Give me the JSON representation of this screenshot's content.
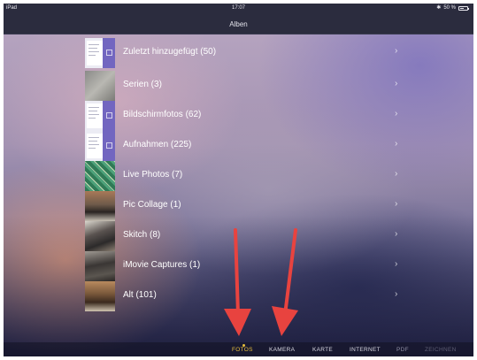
{
  "status_bar": {
    "device": "iPad",
    "time": "17:07",
    "bluetooth_icon": "bluetooth-icon",
    "battery": "50 %",
    "battery_icon": "battery-icon"
  },
  "navbar": {
    "title": "Alben"
  },
  "albums": [
    {
      "label": "Zuletzt hinzugefügt (50)",
      "thumb": "document-screenshot"
    },
    {
      "label": "Serien (3)",
      "thumb": "gray-photo"
    },
    {
      "label": "Bildschirmfotos (62)",
      "thumb": "document-screenshot"
    },
    {
      "label": "Aufnahmen (225)",
      "thumb": "document-screenshot"
    },
    {
      "label": "Live Photos (7)",
      "thumb": "green-pattern-photo"
    },
    {
      "label": "Pic Collage (1)",
      "thumb": "room-photo"
    },
    {
      "label": "Skitch (8)",
      "thumb": "classroom-photo"
    },
    {
      "label": "iMovie Captures (1)",
      "thumb": "classroom-photo"
    },
    {
      "label": "Alt (101)",
      "thumb": "room-photo"
    }
  ],
  "chevron_glyph": "›",
  "tabs": [
    {
      "label": "FOTOS",
      "state": "active"
    },
    {
      "label": "KAMERA",
      "state": "normal"
    },
    {
      "label": "KARTE",
      "state": "normal"
    },
    {
      "label": "INTERNET",
      "state": "normal"
    },
    {
      "label": "PDF",
      "state": "faded"
    },
    {
      "label": "ZEICHNEN",
      "state": "very-faded"
    }
  ],
  "colors": {
    "bar_background": "#2b2c3e",
    "active_tab": "#e6bd3c",
    "annotation_arrow": "#e8433f",
    "document_thumb_accent": "#7266c0"
  }
}
